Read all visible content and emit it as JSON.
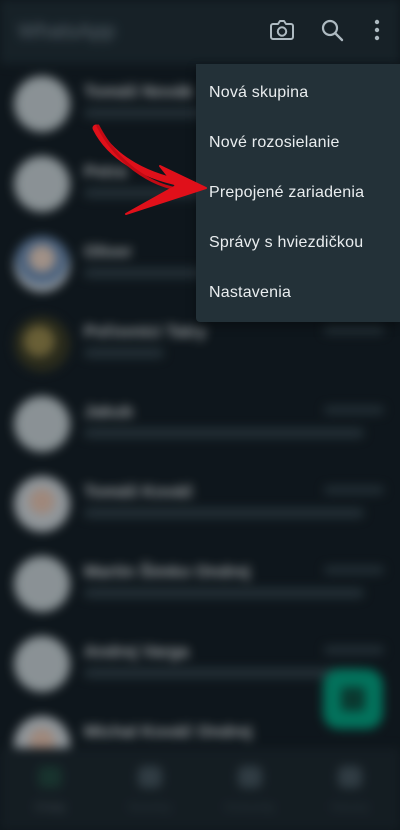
{
  "app": {
    "title": "WhatsApp"
  },
  "toolbar": {
    "icons": [
      "camera-icon",
      "search-icon",
      "more-vert-icon"
    ]
  },
  "menu": {
    "items": [
      {
        "label": "Nová skupina"
      },
      {
        "label": "Nové rozosielanie"
      },
      {
        "label": "Prepojené zariadenia"
      },
      {
        "label": "Správy s hviezdičkou"
      },
      {
        "label": "Nastavenia"
      }
    ],
    "highlighted_item": "Prepojené zariadenia"
  },
  "chats": [
    {
      "name": "Tomáš Novák"
    },
    {
      "name": "Petra"
    },
    {
      "name": "Oliver"
    },
    {
      "name": "Poľovníci Tatry"
    },
    {
      "name": "Jakub"
    },
    {
      "name": "Tomáš Kováč"
    },
    {
      "name": "Martin Šimko Ondrej"
    },
    {
      "name": "Andrej Varga"
    },
    {
      "name": "Michal Kováč Ondrej"
    }
  ],
  "bottom_nav": {
    "tabs": [
      {
        "label": "Chaty"
      },
      {
        "label": "Novinky"
      },
      {
        "label": "Komunity"
      },
      {
        "label": "Hovory"
      }
    ]
  },
  "colors": {
    "background": "#121b22",
    "menu_background": "#233138",
    "menu_text": "#e9edef",
    "accent": "#00a884",
    "annotation_arrow": "#e0101a"
  }
}
